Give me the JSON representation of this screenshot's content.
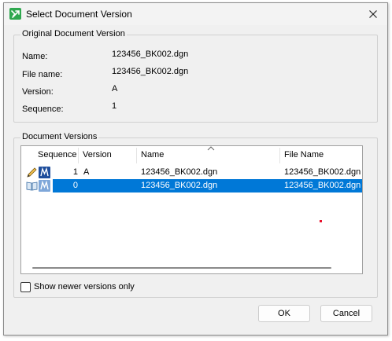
{
  "window": {
    "title": "Select Document Version"
  },
  "original": {
    "legend": "Original Document Version",
    "fields": [
      {
        "label": "Name:",
        "value": "123456_BK002.dgn"
      },
      {
        "label": "File name:",
        "value": "123456_BK002.dgn"
      },
      {
        "label": "Version:",
        "value": "A"
      },
      {
        "label": "Sequence:",
        "value": "1"
      }
    ]
  },
  "versions": {
    "legend": "Document Versions",
    "columns": [
      "Sequence",
      "Version",
      "Name",
      "File Name"
    ],
    "rows": [
      {
        "sequence": "1",
        "version": "A",
        "name": "123456_BK002.dgn",
        "file_name": "123456_BK002.dgn",
        "icons": [
          "pencil-icon",
          "microstation-icon"
        ],
        "selected": false
      },
      {
        "sequence": "0",
        "version": "",
        "name": "123456_BK002.dgn",
        "file_name": "123456_BK002.dgn",
        "icons": [
          "book-icon",
          "microstation-icon"
        ],
        "selected": true
      }
    ]
  },
  "options": {
    "show_newer_label": "Show newer versions only",
    "show_newer_checked": false
  },
  "buttons": {
    "ok": "OK",
    "cancel": "Cancel"
  },
  "colors": {
    "selection": "#0078d7",
    "app_icon": "#2fa84f",
    "ms_icon": "#1f4e9c"
  }
}
